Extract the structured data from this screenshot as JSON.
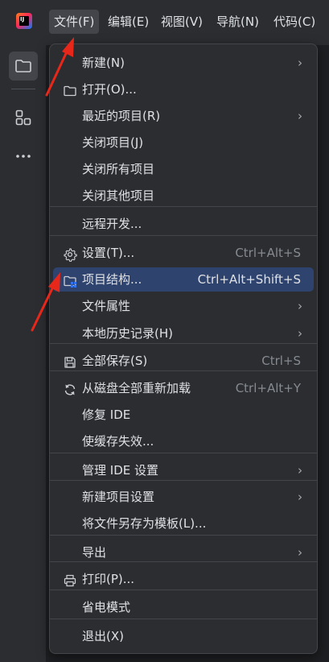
{
  "menubar": {
    "items": [
      {
        "label": "文件(F)",
        "active": true
      },
      {
        "label": "编辑(E)"
      },
      {
        "label": "视图(V)"
      },
      {
        "label": "导航(N)"
      },
      {
        "label": "代码(C)"
      }
    ]
  },
  "toolstrip": {
    "buttons": [
      "folder-icon",
      "structure-icon",
      "more-icon"
    ]
  },
  "file_menu": {
    "items": [
      {
        "label": "新建(N)",
        "submenu": true
      },
      {
        "label": "打开(O)...",
        "icon": "folder-icon"
      },
      {
        "label": "最近的项目(R)",
        "submenu": true
      },
      {
        "label": "关闭项目(J)"
      },
      {
        "label": "关闭所有项目"
      },
      {
        "label": "关闭其他项目"
      },
      {
        "label": "远程开发..."
      },
      {
        "label": "设置(T)...",
        "icon": "gear-icon",
        "shortcut": "Ctrl+Alt+S"
      },
      {
        "label": "项目结构...",
        "icon": "project-structure-icon",
        "shortcut": "Ctrl+Alt+Shift+S",
        "selected": true
      },
      {
        "label": "文件属性",
        "submenu": true
      },
      {
        "label": "本地历史记录(H)",
        "submenu": true
      },
      {
        "label": "全部保存(S)",
        "icon": "save-icon",
        "shortcut": "Ctrl+S"
      },
      {
        "label": "从磁盘全部重新加载",
        "icon": "reload-icon",
        "shortcut": "Ctrl+Alt+Y"
      },
      {
        "label": "修复 IDE"
      },
      {
        "label": "使缓存失效..."
      },
      {
        "label": "管理 IDE 设置",
        "submenu": true
      },
      {
        "label": "新建项目设置",
        "submenu": true
      },
      {
        "label": "将文件另存为模板(L)..."
      },
      {
        "label": "导出",
        "submenu": true
      },
      {
        "label": "打印(P)...",
        "icon": "print-icon"
      },
      {
        "label": "省电模式"
      },
      {
        "label": "退出(X)"
      }
    ],
    "submenu_arrow": "›"
  },
  "colors": {
    "background": "#1e1f22",
    "panel": "#2b2d30",
    "selected": "#2e436e",
    "annotation": "#e8271b"
  }
}
